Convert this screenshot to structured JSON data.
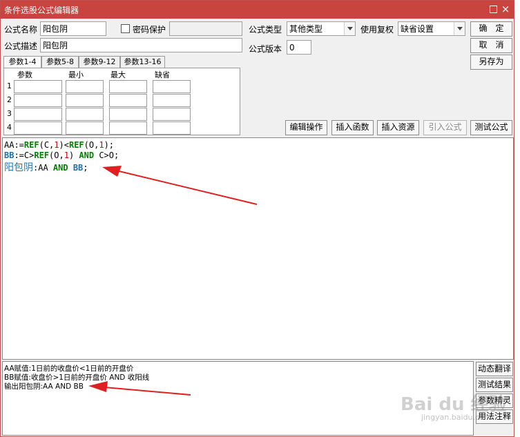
{
  "window": {
    "title": "条件选股公式编辑器"
  },
  "form": {
    "name_label": "公式名称",
    "name_value": "阳包阴",
    "password_label": "密码保护",
    "desc_label": "公式描述",
    "desc_value": "阳包阴",
    "type_label": "公式类型",
    "type_value": "其他类型",
    "rights_label": "使用复权",
    "rights_value": "缺省设置",
    "version_label": "公式版本",
    "version_value": "0"
  },
  "buttons": {
    "ok": "确　定",
    "cancel": "取　消",
    "save_as": "另存为",
    "edit_op": "编辑操作",
    "insert_func": "插入函数",
    "insert_res": "插入资源",
    "import_formula": "引入公式",
    "test_formula": "测试公式"
  },
  "tabs": [
    "参数1-4",
    "参数5-8",
    "参数9-12",
    "参数13-16"
  ],
  "params": {
    "headers": [
      "参数",
      "最小",
      "最大",
      "缺省"
    ],
    "rows": [
      "1",
      "2",
      "3",
      "4"
    ]
  },
  "code": {
    "line1": [
      {
        "t": "AA",
        "c": "c-blk"
      },
      {
        "t": ":=",
        "c": "c-blk"
      },
      {
        "t": "REF",
        "c": "c-grn"
      },
      {
        "t": "(C,",
        "c": "c-blk"
      },
      {
        "t": "1",
        "c": "c-red"
      },
      {
        "t": ")<",
        "c": "c-blk"
      },
      {
        "t": "REF",
        "c": "c-grn"
      },
      {
        "t": "(O,",
        "c": "c-blk"
      },
      {
        "t": "1",
        "c": "c-red"
      },
      {
        "t": ");",
        "c": "c-blk"
      }
    ],
    "line2": [
      {
        "t": "BB",
        "c": "c-blu"
      },
      {
        "t": ":=C>",
        "c": "c-blk"
      },
      {
        "t": "REF",
        "c": "c-grn"
      },
      {
        "t": "(O,",
        "c": "c-blk"
      },
      {
        "t": "1",
        "c": "c-red"
      },
      {
        "t": ") ",
        "c": "c-blk"
      },
      {
        "t": "AND",
        "c": "c-grn"
      },
      {
        "t": " C>",
        "c": "c-blk"
      },
      {
        "t": "O",
        "c": "c-blk"
      },
      {
        "t": ";",
        "c": "c-blk"
      }
    ],
    "line3": [
      {
        "t": "阳包阴",
        "c": "c-big"
      },
      {
        "t": ":AA ",
        "c": "c-blk"
      },
      {
        "t": "AND",
        "c": "c-grn"
      },
      {
        "t": " BB",
        "c": "c-blu"
      },
      {
        "t": ";",
        "c": "c-blk"
      }
    ]
  },
  "output": {
    "lines": [
      "AA赋值:1日前的收盘价<1日前的开盘价",
      "BB赋值:收盘价>1日前的开盘价 AND 收阳线",
      "输出阳包阴:AA AND BB"
    ]
  },
  "side_buttons": [
    "动态翻译",
    "测试结果",
    "参数精灵",
    "用法注释"
  ],
  "watermark": {
    "main": "Bai du 经验",
    "sub": "jingyan.baidu.com"
  },
  "colors": {
    "titlebar": "#c9443f",
    "arrow": "#e02020",
    "keyword": "#008000",
    "number": "#d00000",
    "variable": "#1a6fb0"
  }
}
